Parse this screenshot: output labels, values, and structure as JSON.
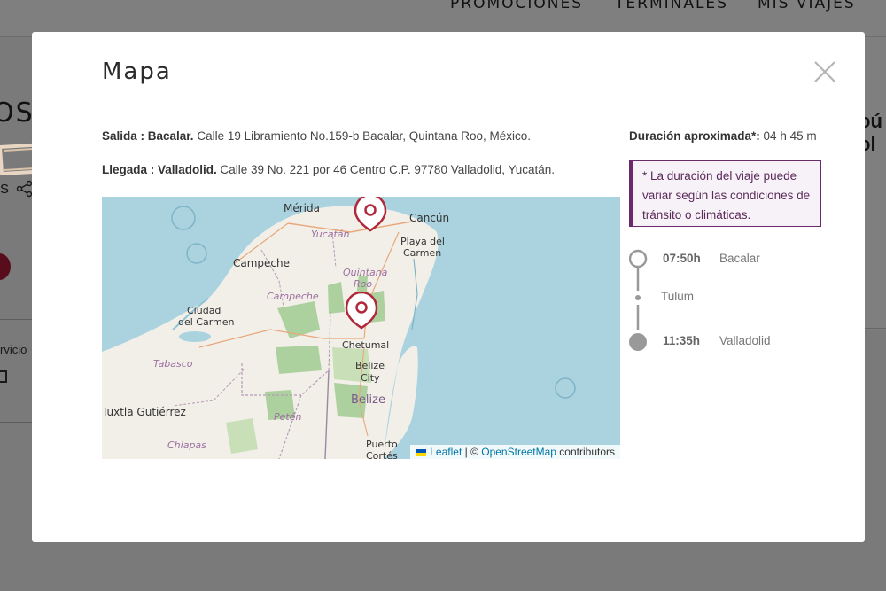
{
  "background": {
    "nav": [
      "PROMOCIONES",
      "TERMINALES",
      "MIS VIAJES"
    ],
    "left_title_fragment": "OS",
    "left_s_fragment": "S",
    "left_servicio_fragment": "rvicio",
    "right_text_fragment": "oú\nol"
  },
  "modal": {
    "title": "Mapa",
    "salida_label": "Salida : Bacalar.",
    "salida_address": " Calle 19 Libramiento No.159-b Bacalar, Quintana Roo, México.",
    "llegada_label": "Llegada : Valladolid.",
    "llegada_address": " Calle 39 No. 221 por 46 Centro C.P. 97780 Valladolid, Yucatán.",
    "duration_label": "Duración aproximada*:",
    "duration_value": " 04 h 45 m",
    "note": "* La duración del viaje puede variar según las condiciones de tránsito o climáticas.",
    "timeline": [
      {
        "time": "07:50h",
        "city": "Bacalar",
        "type": "origin"
      },
      {
        "time": "",
        "city": "Tulum",
        "type": "stop"
      },
      {
        "time": "11:35h",
        "city": "Valladolid",
        "type": "destination"
      }
    ],
    "map": {
      "labels": {
        "merida": "Mérida",
        "cancun": "Cancún",
        "yucatan": "Yucatán",
        "playa1": "Playa del",
        "playa2": "Carmen",
        "campeche": "Campeche",
        "quintana1": "Quintana",
        "quintana2": "Roo",
        "campeche_state": "Campeche",
        "ciudad1": "Ciudad",
        "ciudad2": "del Carmen",
        "chetumal": "Chetumal",
        "tabasco": "Tabasco",
        "belize_city1": "Belize",
        "belize_city2": "City",
        "belize": "Belize",
        "tuxtla": "Tuxtla Gutiérrez",
        "peten": "Petén",
        "chiapas": "Chiapas",
        "puerto1": "Puerto",
        "puerto2": "Cortés"
      },
      "attribution": {
        "leaflet": "Leaflet",
        "separator": " | © ",
        "osm": "OpenStreetMap",
        "contributors": " contributors"
      }
    }
  },
  "colors": {
    "accent_purple": "#6b2a6b",
    "marker_red": "#b0283a",
    "water": "#aad3df",
    "land": "#f2efe9",
    "forest": "#add19e"
  }
}
